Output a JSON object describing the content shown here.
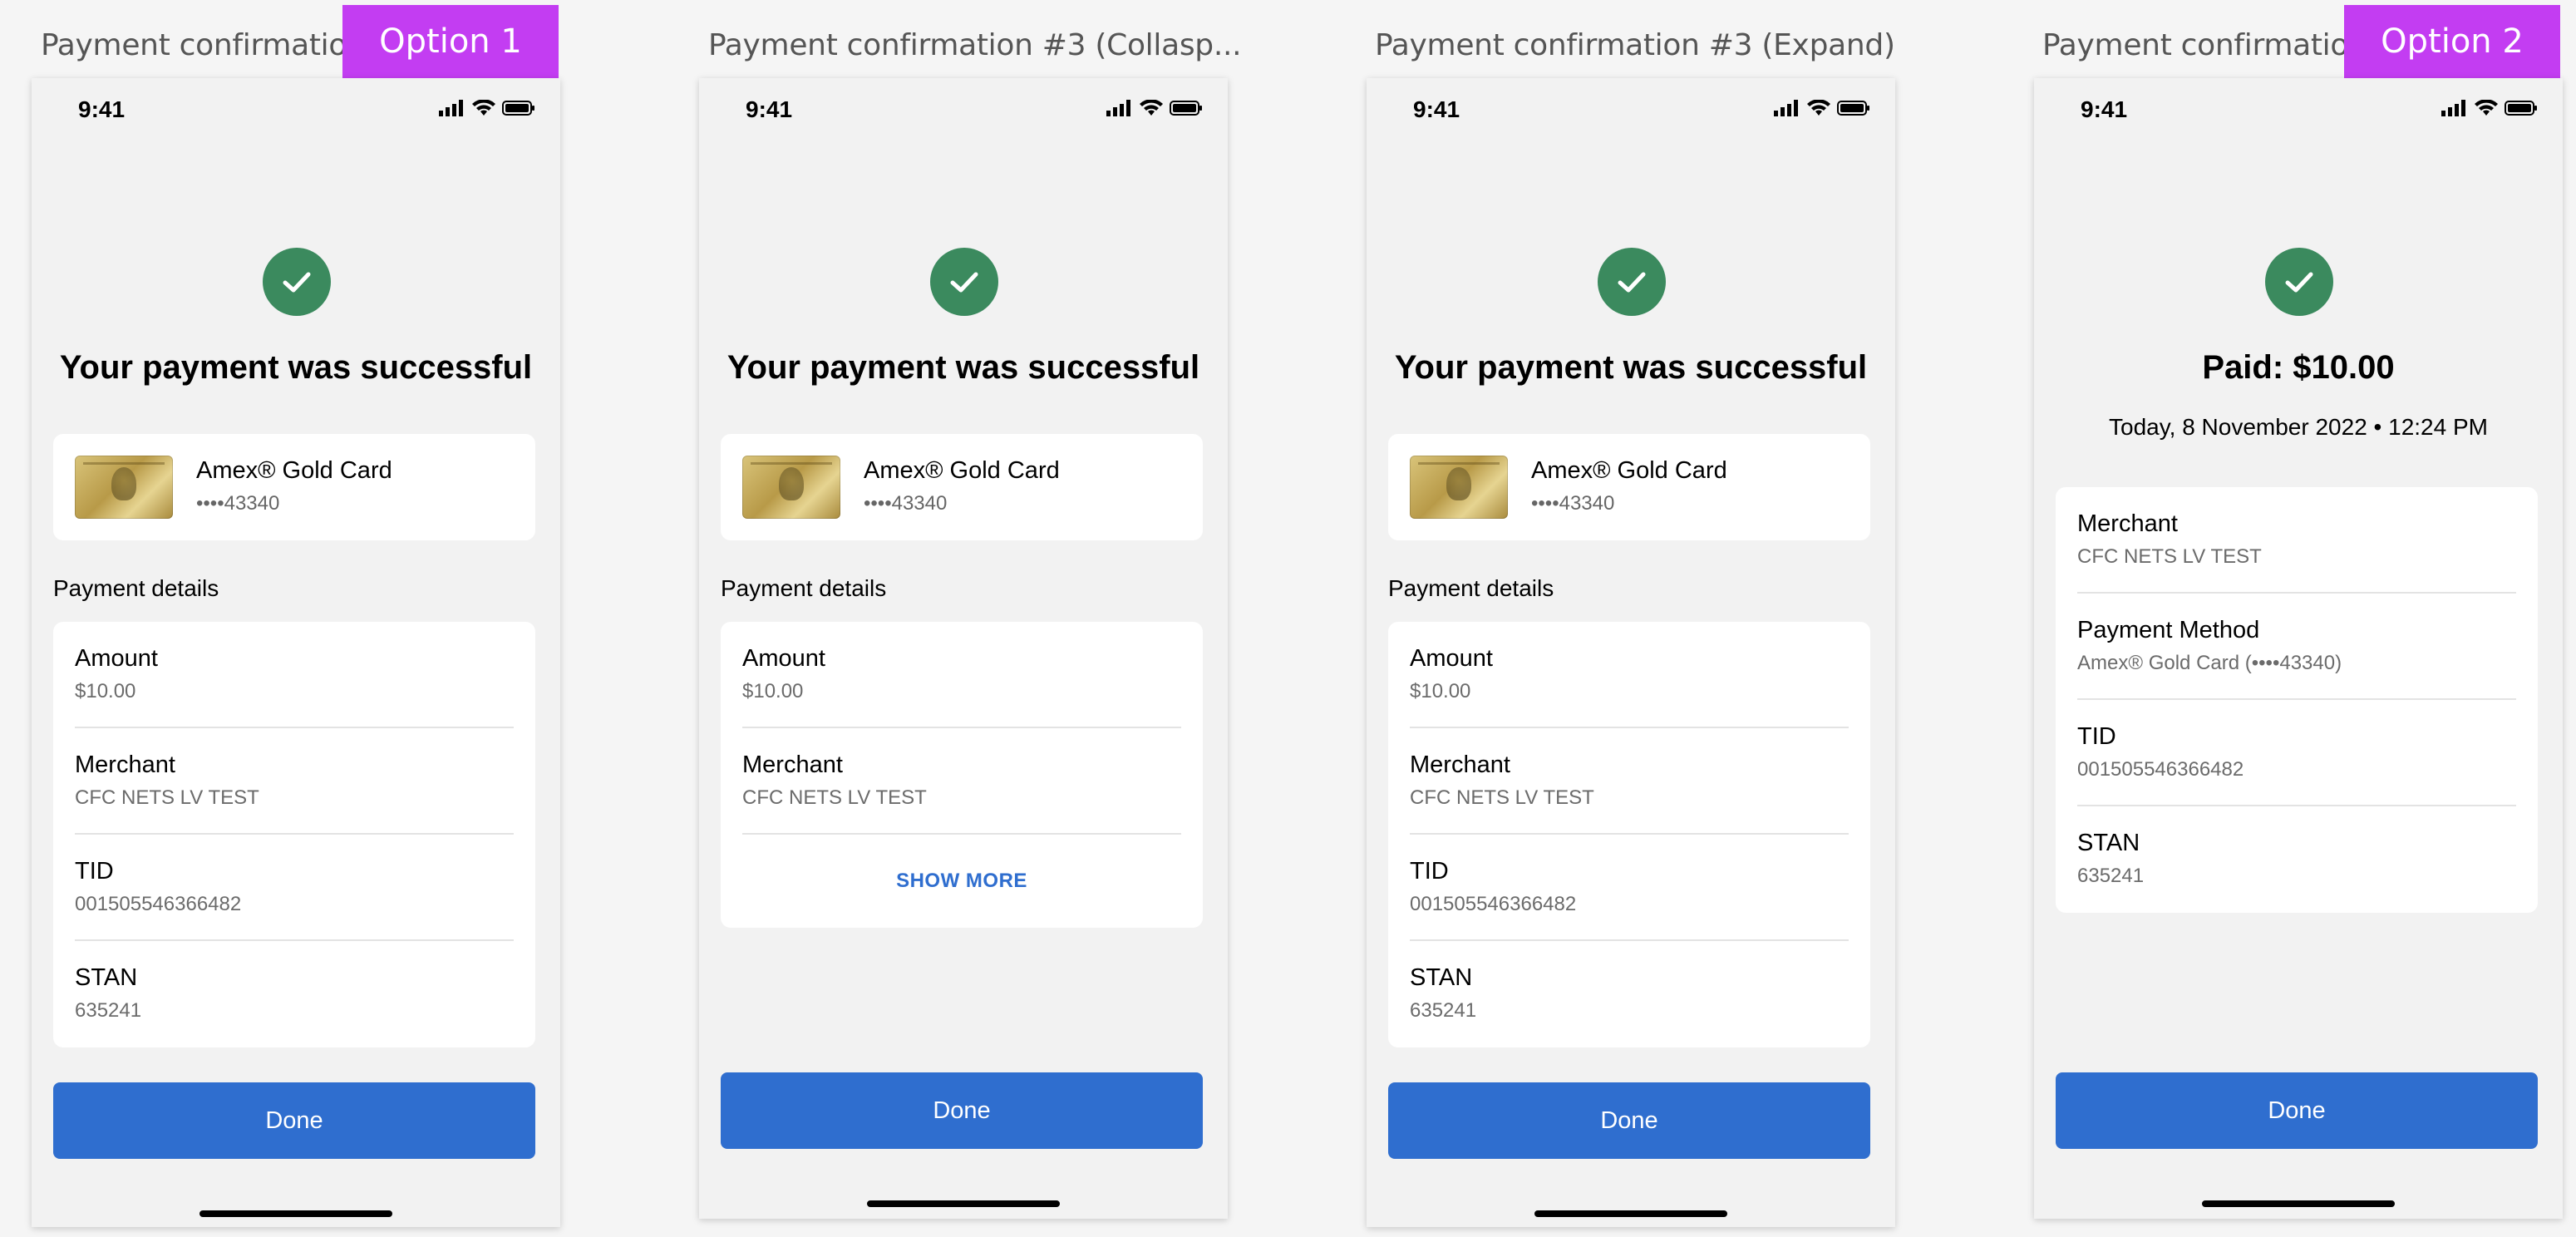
{
  "frames": [
    {
      "title": "Payment confirmation #1",
      "tag": "Option 1"
    },
    {
      "title": "Payment confirmation #3 (Collasp..."
    },
    {
      "title": "Payment confirmation #3 (Expand)"
    },
    {
      "title": "Payment confirmation #2",
      "tag": "Option 2"
    }
  ],
  "status": {
    "time": "9:41"
  },
  "success": {
    "headline": "Your payment was successful"
  },
  "card": {
    "name": "Amex® Gold Card",
    "number": "••••43340"
  },
  "section": {
    "payment_details": "Payment details"
  },
  "details": {
    "amount_label": "Amount",
    "amount_value": "$10.00",
    "merchant_label": "Merchant",
    "merchant_value": "CFC NETS LV TEST",
    "tid_label": "TID",
    "tid_value": "001505546366482",
    "stan_label": "STAN",
    "stan_value": "635241",
    "method_label": "Payment Method",
    "method_value": "Amex® Gold Card (••••43340)"
  },
  "show_more": "SHOW MORE",
  "done": "Done",
  "paid": {
    "title": "Paid: $10.00",
    "date": "Today, 8 November 2022 • 12:24 PM"
  },
  "colors": {
    "accent": "#2f6ecf",
    "success": "#3b8a5e",
    "tag": "#c33df2"
  }
}
